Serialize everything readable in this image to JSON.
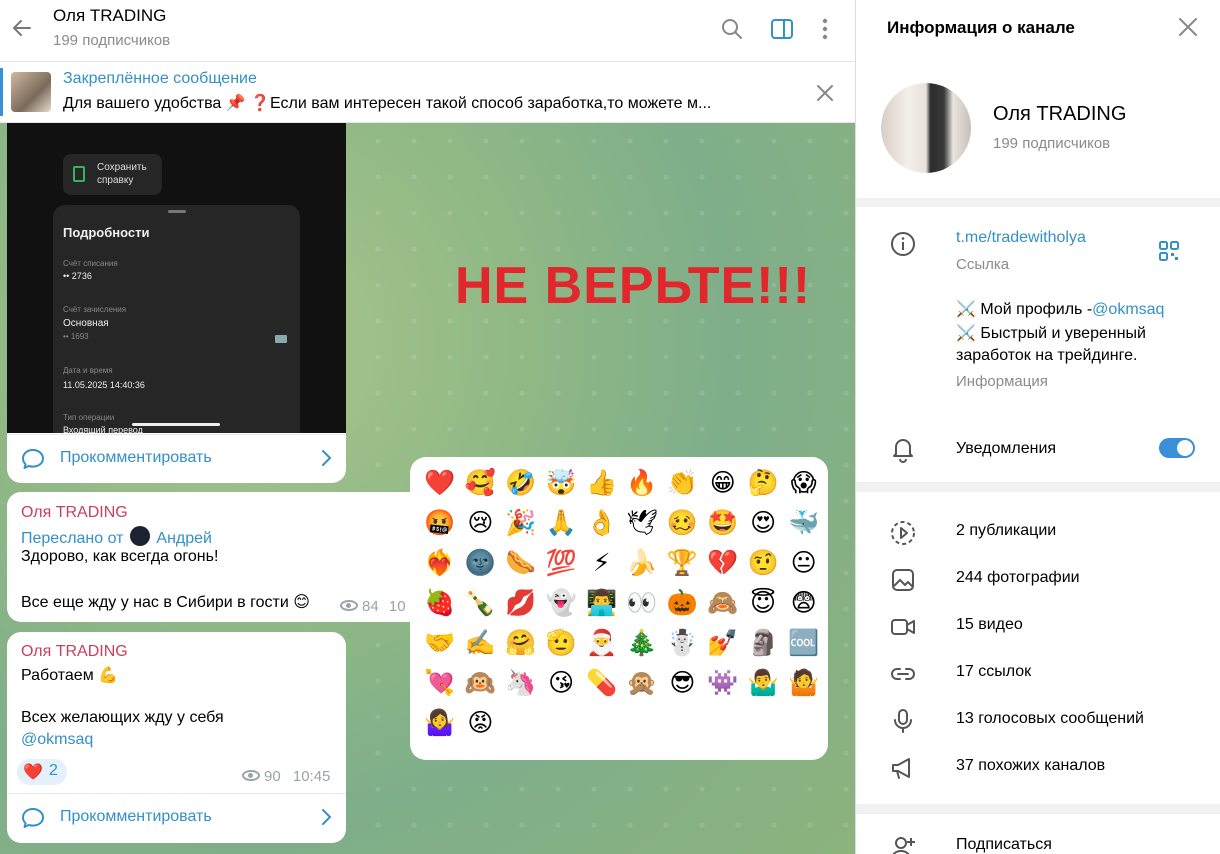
{
  "chat": {
    "title": "Оля TRADING",
    "subscribers": "199 подписчиков",
    "pinned": {
      "label": "Закреплённое сообщение",
      "text": "Для вашего удобства 📌 ❓Если вам интересен такой способ заработка,то можете м..."
    },
    "receipt": {
      "save_label": "Сохранить справку",
      "title": "Подробности",
      "debit_label": "Счёт списания",
      "debit_value": "•• 2736",
      "credit_label": "Счёт зачисления",
      "credit_value": "Основная",
      "credit_sub": "•• 1693",
      "date_label": "Дата и время",
      "date_value": "11.05.2025 14:40:36",
      "type_label": "Тип операции",
      "type_value": "Входящий перевод"
    },
    "comment_label": "Прокомментировать",
    "overlay_text": "НЕ ВЕРЬТЕ!!!",
    "messages": [
      {
        "sender": "Оля TRADING",
        "forward_prefix": "Переслано от",
        "forward_name": "Андрей",
        "line1": "Здорово, как всегда огонь!",
        "line2": "Все еще жду у нас в Сибири в гости 😊",
        "views": "84",
        "time": "10"
      },
      {
        "sender": "Оля TRADING",
        "line1": "Работаем 💪",
        "line2": "Всех желающих жду у себя",
        "mention": "@okmsaq",
        "reaction_emoji": "❤️",
        "reaction_count": "2",
        "views": "90",
        "time": "10:45"
      }
    ],
    "emojis": [
      "❤️",
      "🥰",
      "🤣",
      "🤯",
      "👍",
      "🔥",
      "👏",
      "😁",
      "🤔",
      "😱",
      "🤬",
      "😢",
      "🎉",
      "🙏",
      "👌",
      "🕊",
      "🥴",
      "🤩",
      "😍",
      "🐳",
      "❤️‍🔥",
      "🌚",
      "🌭",
      "💯",
      "⚡",
      "🍌",
      "🏆",
      "💔",
      "🤨",
      "😐",
      "🍓",
      "🍾",
      "💋",
      "👻",
      "👨‍💻",
      "👀",
      "🎃",
      "🙈",
      "😇",
      "😨",
      "🤝",
      "✍️",
      "🤗",
      "🫡",
      "🎅",
      "🎄",
      "☃️",
      "💅",
      "🗿",
      "🆒",
      "💘",
      "🙉",
      "🦄",
      "😘",
      "💊",
      "🙊",
      "😎",
      "👾",
      "🤷‍♂️",
      "🤷",
      "🤷‍♀️",
      "😡"
    ]
  },
  "info": {
    "header": "Информация о канале",
    "name": "Оля TRADING",
    "subscribers": "199 подписчиков",
    "link": "t.me/tradewitholya",
    "link_label": "Ссылка",
    "about_line1": "⚔️ Мой профиль -",
    "about_mention": "@okmsaq",
    "about_line2": "⚔️ Быстрый и уверенный",
    "about_line3": "заработок на трейдинге.",
    "about_label": "Информация",
    "notifications": "Уведомления",
    "notifications_on": true,
    "stats": [
      {
        "icon": "story-icon",
        "label": "2 публикации"
      },
      {
        "icon": "photo-icon",
        "label": "244 фотографии"
      },
      {
        "icon": "video-icon",
        "label": "15 видео"
      },
      {
        "icon": "link-icon",
        "label": "17 ссылок"
      },
      {
        "icon": "microphone-icon",
        "label": "13 голосовых сообщений"
      },
      {
        "icon": "megaphone-icon",
        "label": "37 похожих каналов"
      }
    ],
    "subscribe": "Подписаться"
  },
  "colors": {
    "accent": "#3390c8",
    "sender": "#c9405c",
    "warning": "#e1262c",
    "toggle": "#3a8fd6"
  }
}
